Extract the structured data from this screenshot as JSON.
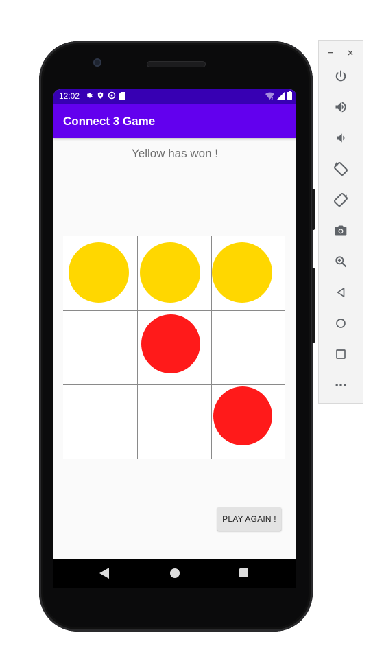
{
  "status_bar": {
    "time": "12:02",
    "left_icons": [
      "gear-icon",
      "shield-icon",
      "vpn-icon",
      "sd-card-icon"
    ],
    "right_icons": [
      "wifi-icon",
      "cell-signal-icon",
      "battery-icon"
    ]
  },
  "app_bar": {
    "title": "Connect 3 Game"
  },
  "game": {
    "status_message": "Yellow has won !",
    "board": [
      [
        "yellow",
        "yellow",
        "yellow"
      ],
      [
        "empty",
        "red",
        "empty"
      ],
      [
        "empty",
        "empty",
        "red"
      ]
    ],
    "colors": {
      "yellow": "#ffd700",
      "red": "#ff1a1a",
      "grid": "#8a8a8a"
    }
  },
  "play_again_label": "PLAY AGAIN !",
  "nav_bar": {
    "items": [
      "back-icon",
      "home-icon",
      "overview-icon"
    ]
  },
  "emulator_toolbar": {
    "window_controls": [
      "minimize-icon",
      "close-icon"
    ],
    "buttons": [
      "power-icon",
      "volume-up-icon",
      "volume-down-icon",
      "rotate-left-icon",
      "rotate-right-icon",
      "camera-icon",
      "zoom-icon",
      "back-icon",
      "home-icon",
      "overview-icon",
      "more-icon"
    ]
  },
  "theme": {
    "status_bar": "#3700b3",
    "app_bar": "#6200ee"
  }
}
